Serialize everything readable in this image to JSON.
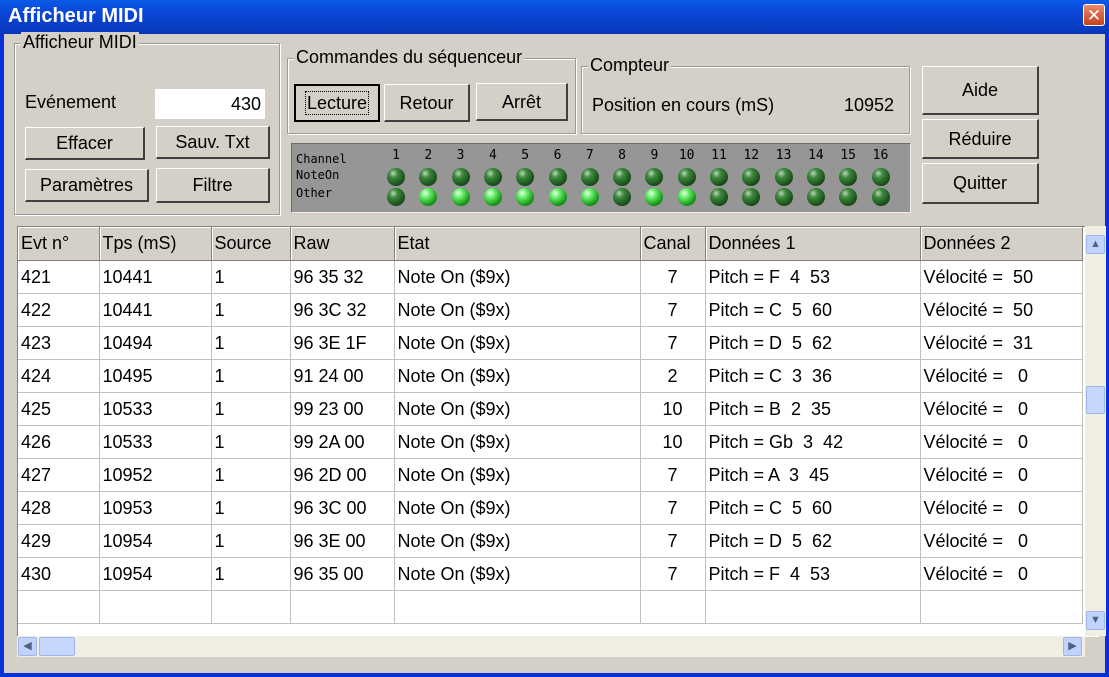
{
  "window": {
    "title": "Afficheur MIDI",
    "close_glyph": "✕"
  },
  "afficheur": {
    "legend": "Afficheur MIDI",
    "evenement_label": "Evénement",
    "evenement_value": "430",
    "effacer": "Effacer",
    "sauv_txt": "Sauv. Txt",
    "parametres": "Paramètres",
    "filtre": "Filtre"
  },
  "sequenceur": {
    "legend": "Commandes du séquenceur",
    "lecture": "Lecture",
    "retour": "Retour",
    "arret": "Arrêt"
  },
  "compteur": {
    "legend": "Compteur",
    "position_label": "Position en cours (mS)",
    "position_value": "10952"
  },
  "side_buttons": {
    "aide": "Aide",
    "reduire": "Réduire",
    "quitter": "Quitter"
  },
  "leds": {
    "row_labels": [
      "Channel",
      "NoteOn",
      "Other"
    ],
    "channels": [
      "1",
      "2",
      "3",
      "4",
      "5",
      "6",
      "7",
      "8",
      "9",
      "10",
      "11",
      "12",
      "13",
      "14",
      "15",
      "16"
    ],
    "noteon_lit": [
      0,
      0,
      0,
      0,
      0,
      0,
      0,
      0,
      0,
      0,
      0,
      0,
      0,
      0,
      0,
      0
    ],
    "other_lit": [
      0,
      1,
      1,
      1,
      1,
      1,
      1,
      0,
      1,
      1,
      0,
      0,
      0,
      0,
      0,
      0
    ]
  },
  "table": {
    "columns": [
      "Evt n°",
      "Tps (mS)",
      "Source",
      "Raw",
      "Etat",
      "Canal",
      "Données 1",
      "Données 2"
    ],
    "rows": [
      [
        "421",
        "10441",
        "1",
        "96 35 32",
        "Note On ($9x)",
        "7",
        "Pitch = F  4  53",
        "Vélocité =  50"
      ],
      [
        "422",
        "10441",
        "1",
        "96 3C 32",
        "Note On ($9x)",
        "7",
        "Pitch = C  5  60",
        "Vélocité =  50"
      ],
      [
        "423",
        "10494",
        "1",
        "96 3E 1F",
        "Note On ($9x)",
        "7",
        "Pitch = D  5  62",
        "Vélocité =  31"
      ],
      [
        "424",
        "10495",
        "1",
        "91 24 00",
        "Note On ($9x)",
        "2",
        "Pitch = C  3  36",
        "Vélocité =   0"
      ],
      [
        "425",
        "10533",
        "1",
        "99 23 00",
        "Note On ($9x)",
        "10",
        "Pitch = B  2  35",
        "Vélocité =   0"
      ],
      [
        "426",
        "10533",
        "1",
        "99 2A 00",
        "Note On ($9x)",
        "10",
        "Pitch = Gb  3  42",
        "Vélocité =   0"
      ],
      [
        "427",
        "10952",
        "1",
        "96 2D 00",
        "Note On ($9x)",
        "7",
        "Pitch = A  3  45",
        "Vélocité =   0"
      ],
      [
        "428",
        "10953",
        "1",
        "96 3C 00",
        "Note On ($9x)",
        "7",
        "Pitch = C  5  60",
        "Vélocité =   0"
      ],
      [
        "429",
        "10954",
        "1",
        "96 3E 00",
        "Note On ($9x)",
        "7",
        "Pitch = D  5  62",
        "Vélocité =   0"
      ],
      [
        "430",
        "10954",
        "1",
        "96 35 00",
        "Note On ($9x)",
        "7",
        "Pitch = F  4  53",
        "Vélocité =   0"
      ]
    ]
  },
  "colors": {
    "title_bar": "#0a46d6",
    "led_on": "#3ad43a",
    "led_off": "#1c541c",
    "face": "#d4d0c8"
  }
}
